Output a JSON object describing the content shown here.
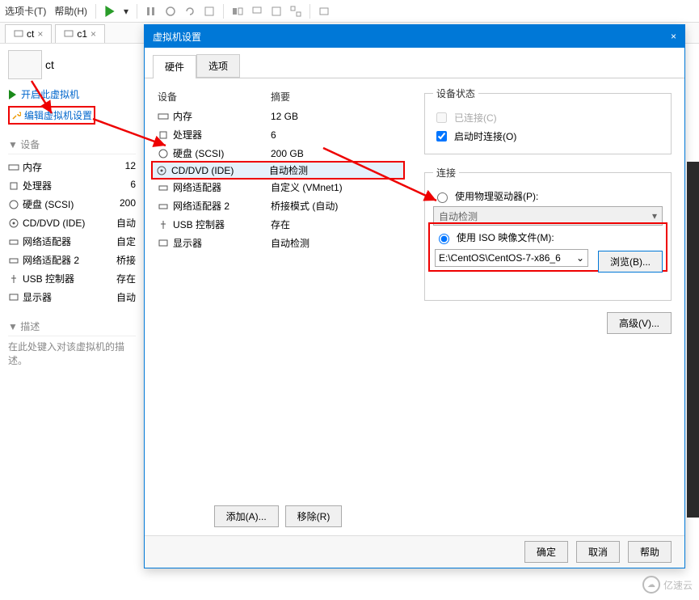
{
  "topbar": {
    "tabs_menu": "选项卡(T)",
    "help_menu": "帮助(H)"
  },
  "tabs": [
    {
      "name": "ct",
      "close": "×"
    },
    {
      "name": "c1",
      "close": "×"
    }
  ],
  "vm_label": "ct",
  "links": {
    "power_on": "开启此虚拟机",
    "edit_settings": "编辑虚拟机设置"
  },
  "sections": {
    "devices": "设备",
    "description": "描述"
  },
  "left_hw": [
    {
      "icon": "memory-icon",
      "name": "内存",
      "val": "12"
    },
    {
      "icon": "cpu-icon",
      "name": "处理器",
      "val": "6"
    },
    {
      "icon": "disk-icon",
      "name": "硬盘 (SCSI)",
      "val": "200"
    },
    {
      "icon": "cd-icon",
      "name": "CD/DVD (IDE)",
      "val": "自动"
    },
    {
      "icon": "network-icon",
      "name": "网络适配器",
      "val": "自定"
    },
    {
      "icon": "network-icon",
      "name": "网络适配器 2",
      "val": "桥接"
    },
    {
      "icon": "usb-icon",
      "name": "USB 控制器",
      "val": "存在"
    },
    {
      "icon": "display-icon",
      "name": "显示器",
      "val": "自动"
    }
  ],
  "desc_placeholder": "在此处键入对该虚拟机的描述。",
  "dialog": {
    "title": "虚拟机设置",
    "close": "×",
    "tab_hw": "硬件",
    "tab_opt": "选项",
    "col_device": "设备",
    "col_summary": "摘要",
    "rows": [
      {
        "icon": "memory-icon",
        "name": "内存",
        "summary": "12 GB"
      },
      {
        "icon": "cpu-icon",
        "name": "处理器",
        "summary": "6"
      },
      {
        "icon": "disk-icon",
        "name": "硬盘 (SCSI)",
        "summary": "200 GB"
      },
      {
        "icon": "cd-icon",
        "name": "CD/DVD (IDE)",
        "summary": "自动检测"
      },
      {
        "icon": "network-icon",
        "name": "网络适配器",
        "summary": "自定义 (VMnet1)"
      },
      {
        "icon": "network-icon",
        "name": "网络适配器 2",
        "summary": "桥接模式 (自动)"
      },
      {
        "icon": "usb-icon",
        "name": "USB 控制器",
        "summary": "存在"
      },
      {
        "icon": "display-icon",
        "name": "显示器",
        "summary": "自动检测"
      }
    ],
    "add_btn": "添加(A)...",
    "remove_btn": "移除(R)",
    "status_group": "设备状态",
    "connected": "已连接(C)",
    "connect_at_power": "启动时连接(O)",
    "connection_group": "连接",
    "use_physical": "使用物理驱动器(P):",
    "auto_detect": "自动检测",
    "use_iso": "使用 ISO 映像文件(M):",
    "iso_path": "E:\\CentOS\\CentOS-7-x86_6",
    "browse": "浏览(B)...",
    "advanced": "高级(V)...",
    "ok": "确定",
    "cancel": "取消",
    "help": "帮助"
  },
  "watermark": "亿速云"
}
